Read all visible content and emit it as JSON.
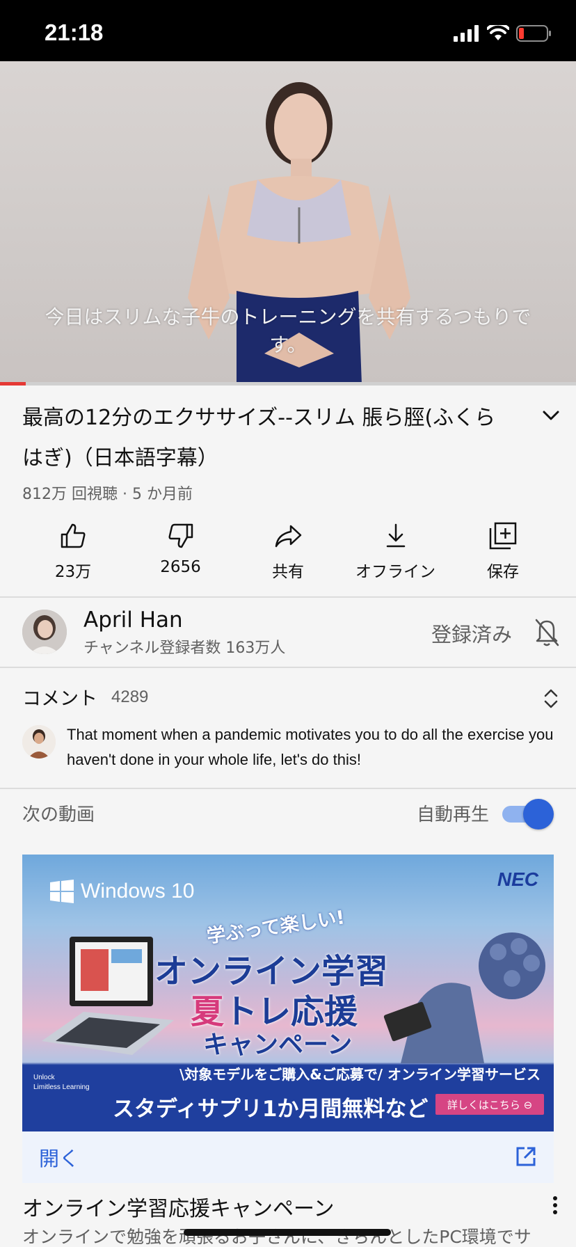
{
  "status_bar": {
    "time": "21:18"
  },
  "video": {
    "subtitle": "今日はスリムな子牛のトレーニングを共有するつもりです。",
    "progress": 0.045
  },
  "details": {
    "title": "最高の12分のエクササイズ--スリム 脹ら脛(ふくらはぎ)（日本語字幕）",
    "meta": "812万 回視聴 · 5 か月前"
  },
  "actions": [
    {
      "icon": "thumbs-up-icon",
      "label": "23万"
    },
    {
      "icon": "thumbs-down-icon",
      "label": "2656"
    },
    {
      "icon": "share-icon",
      "label": "共有"
    },
    {
      "icon": "download-icon",
      "label": "オフライン"
    },
    {
      "icon": "save-playlist-icon",
      "label": "保存"
    }
  ],
  "channel": {
    "name": "April Han",
    "subscribers": "チャンネル登録者数 163万人",
    "subscribe_state": "登録済み"
  },
  "comments": {
    "title": "コメント",
    "count": "4289",
    "top_comment": "That moment when a pandemic motivates you to do all the exercise you haven't  done in your whole life, let's do this!"
  },
  "up_next": {
    "label": "次の動画",
    "autoplay_label": "自動再生",
    "autoplay_on": true
  },
  "ad": {
    "windows_text": "Windows 10",
    "brand": "NEC",
    "subheading": "学ぶって楽しい!",
    "headline_1": "オンライン学習",
    "headline_2_pink": "夏",
    "headline_2_rest": "トレ応援",
    "headline_3": "キャンペーン",
    "band_line_1": "\\対象モデルをご購入&ご応募で/ オンライン学習サービス",
    "band_line_2": "スタディサプリ1か月間無料など",
    "cta": "詳しくはこちら ⊖",
    "tagline": "Unlock\nLimitless Learning",
    "open_label": "開く",
    "title": "オンライン学習応援キャンペーン",
    "description": "オンラインで勉強を頑張るお子さんに、きちんとしたPC環境でサ"
  },
  "colors": {
    "accent": "#2c62d8",
    "progress": "#e53935",
    "ad_pink": "#d63a7b",
    "ad_navy": "#1c3c96"
  }
}
